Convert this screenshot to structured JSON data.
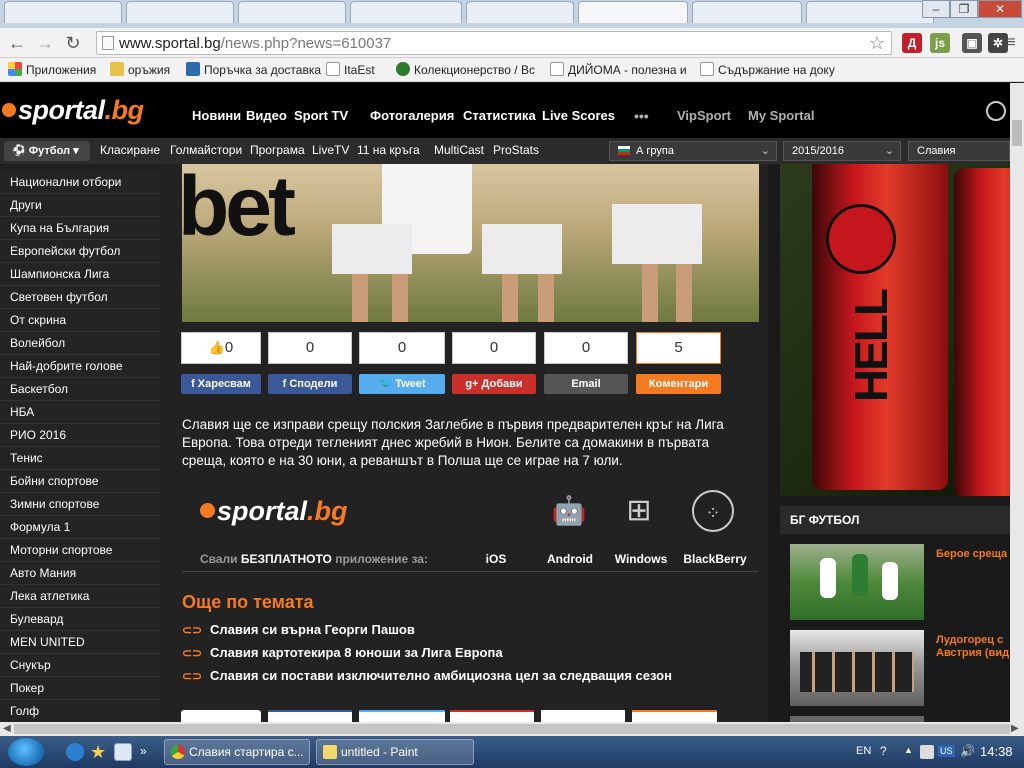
{
  "browser": {
    "url_domain": "www.sportal.bg",
    "url_path": "/news.php?news=610037",
    "bookmarks": [
      "Приложения",
      "оръжия",
      "Поръчка за доставка",
      "ItaEst",
      "Колекционерство / Вс",
      "ДИЙОМА - полезна и",
      "Съдържание на доку"
    ]
  },
  "site": {
    "logo_main": "sportal",
    "logo_tld": ".bg",
    "topnav": [
      "Новини",
      "Видео",
      "Sport TV",
      "Фотогалерия",
      "Статистика",
      "Live Scores"
    ],
    "topnav_dots": "•••",
    "topnav_right": [
      "VipSport",
      "My Sportal"
    ],
    "sport_select": "Футбол",
    "subnav": [
      "Класиране",
      "Голмайстори",
      "Програма",
      "LiveTV",
      "11 на кръга",
      "MultiCast",
      "ProStats"
    ],
    "dropdowns": {
      "league": "А група",
      "season": "2015/2016",
      "team": "Славия"
    }
  },
  "sidebar": [
    "Национални отбори",
    "Други",
    "Купа на България",
    "Европейски футбол",
    "Шампионска Лига",
    "Световен футбол",
    "От скрина",
    "Волейбол",
    "Най-добрите голове",
    "Баскетбол",
    "НБА",
    "РИО 2016",
    "Тенис",
    "Бойни спортове",
    "Зимни спортове",
    "Формула 1",
    "Моторни спортове",
    "Авто Мания",
    "Лека атлетика",
    "Булевард",
    "MEN UNITED",
    "Снукър",
    "Покер",
    "Голф"
  ],
  "counters": [
    "0",
    "0",
    "0",
    "0",
    "0",
    "5"
  ],
  "share_buttons": [
    "Харесвам",
    "Сподели",
    "Tweet",
    "Добави",
    "Email",
    "Коментари"
  ],
  "article_text": "Славия ще се изправи срещу полския Заглебие в първия предварителен кръг на Лига Европа. Това отреди тегленият днес жребий в Нион. Белите са домакини в първата среща, която е на 30 юни, а реваншът в Полша ще се играе на 7 юли.",
  "app_promo": {
    "prefix": "Свали ",
    "free": "БЕЗПЛАТНОТО",
    "suffix": " приложение за:",
    "platforms": [
      "iOS",
      "Android",
      "Windows",
      "BlackBerry"
    ]
  },
  "more": {
    "title": "Още по темата",
    "items": [
      "Славия си върна Георги Пашов",
      "Славия картотекира 8 юноши за Лига Европа",
      "Славия си постави изключително амбициозна цел за следващия сезон"
    ]
  },
  "rightcol": {
    "section_title": "БГ ФУТБОЛ",
    "news": [
      "Берое среща",
      "Лудогорец с Австрия (вид"
    ]
  },
  "ad": {
    "brand": "HELL"
  },
  "taskbar": {
    "tasks": [
      "Славия стартира с...",
      "untitled - Paint"
    ],
    "lang": "EN",
    "time": "14:38"
  }
}
